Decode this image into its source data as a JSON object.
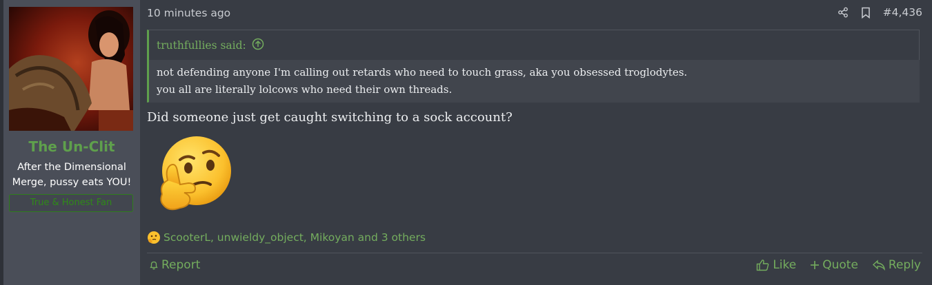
{
  "user": {
    "username": "The Un-Clit",
    "title_line1": "After the Dimensional",
    "title_line2": "Merge, pussy eats YOU!",
    "banner": "True & Honest Fan",
    "avatar_icon": "avatar-image"
  },
  "post": {
    "time": "10 minutes ago",
    "number": "#4,436",
    "quote": {
      "author_label": "truthfullies said:",
      "line1": "not defending anyone I'm calling out retards who need to touch grass, aka you obsessed troglodytes.",
      "line2": "you all are literally lolcows who need their own threads."
    },
    "message": "Did someone just get caught switching to a sock account?",
    "emoji_icon": "thinking-face-icon",
    "reactions_text": "ScooterL, unwieldy_object, Mikoyan and 3 others"
  },
  "actions": {
    "report": "Report",
    "like": "Like",
    "quote": "Quote",
    "reply": "Reply"
  },
  "colors": {
    "accent_green": "#5fa04c",
    "background": "#383c44",
    "sidebar": "#4a4e58"
  }
}
